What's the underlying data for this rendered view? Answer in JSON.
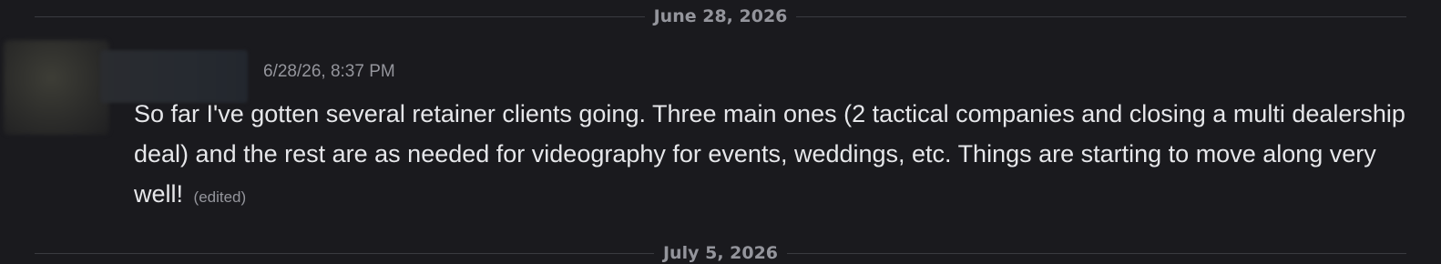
{
  "date_divider": {
    "label": "June 28, 2026"
  },
  "next_date_divider": {
    "label": "July 5, 2026"
  },
  "message": {
    "timestamp": "6/28/26, 8:37 PM",
    "content": "So far I've gotten several retainer clients going.  Three main ones (2 tactical companies and closing a multi dealership deal) and the rest are as needed for videography for events, weddings, etc. Things are starting to move along very well!",
    "edited_label": "(edited)"
  }
}
